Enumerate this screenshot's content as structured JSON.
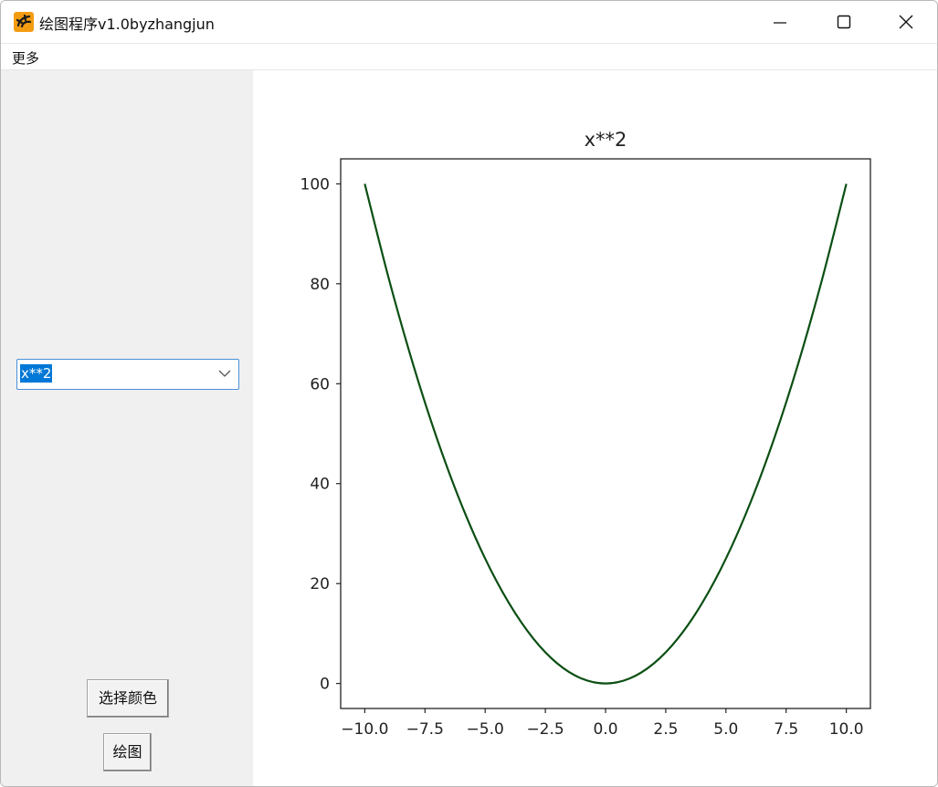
{
  "window": {
    "title": "绘图程序v1.0byzhangjun",
    "app_icon": "app-logo-icon",
    "controls": [
      "minimize-icon",
      "maximize-icon",
      "close-icon"
    ]
  },
  "menu": {
    "items": [
      {
        "label": "更多"
      }
    ]
  },
  "left_panel": {
    "function_combo": {
      "value": "x**2",
      "icon": "chevron-down-icon"
    },
    "color_button_label": "选择颜色",
    "draw_button_label": "绘图"
  },
  "colors": {
    "curve": "#0b4f13",
    "selection": "#0078d7",
    "panel_bg": "#f0f0f0"
  },
  "chart_data": {
    "type": "line",
    "title": "x**2",
    "xlabel": "",
    "ylabel": "",
    "xlim": [
      -11,
      11
    ],
    "ylim": [
      -5,
      105
    ],
    "xticks": [
      -10,
      -7.5,
      -5,
      -2.5,
      0,
      2.5,
      5,
      7.5,
      10
    ],
    "xtick_labels": [
      "−10.0",
      "−7.5",
      "−5.0",
      "−2.5",
      "0.0",
      "2.5",
      "5.0",
      "7.5",
      "10.0"
    ],
    "yticks": [
      0,
      20,
      40,
      60,
      80,
      100
    ],
    "ytick_labels": [
      "0",
      "20",
      "40",
      "60",
      "80",
      "100"
    ],
    "grid": false,
    "series": [
      {
        "color": "#0b4f13",
        "x": [
          -10,
          -9,
          -8,
          -7,
          -6,
          -5,
          -4,
          -3,
          -2,
          -1,
          0,
          1,
          2,
          3,
          4,
          5,
          6,
          7,
          8,
          9,
          10
        ],
        "y": [
          100,
          81,
          64,
          49,
          36,
          25,
          16,
          9,
          4,
          1,
          0,
          1,
          4,
          9,
          16,
          25,
          36,
          49,
          64,
          81,
          100
        ]
      }
    ]
  }
}
